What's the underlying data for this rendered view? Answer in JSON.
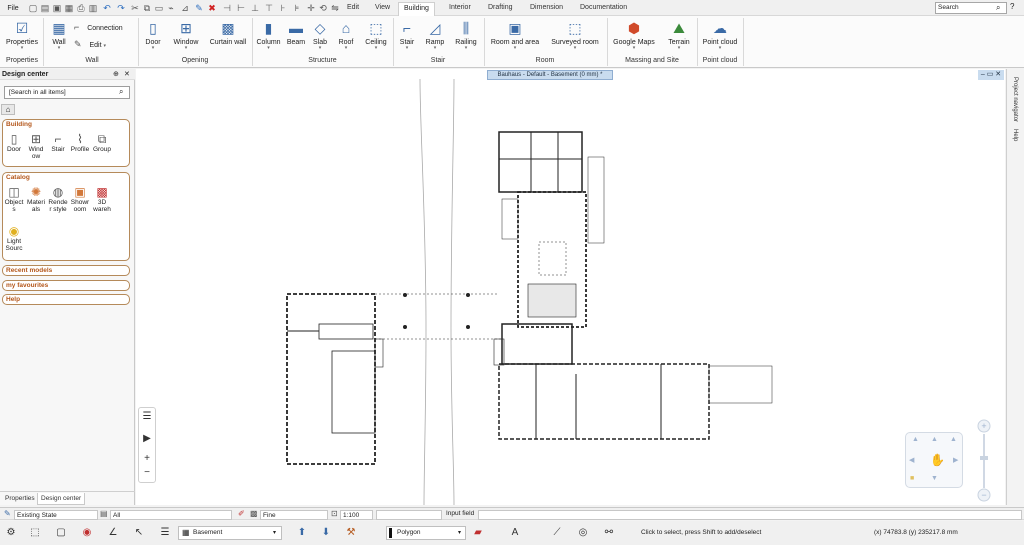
{
  "topbar": {
    "file": "File",
    "menus": [
      "Edit",
      "View",
      "Building",
      "Interior",
      "Drafting",
      "Dimension",
      "Documentation"
    ],
    "active_menu": "Building",
    "search_placeholder": "Search",
    "help": "?"
  },
  "ribbon": {
    "properties": {
      "label": "Properties",
      "group": "Properties"
    },
    "wall": {
      "wall": "Wall",
      "connection": "Connection",
      "edit": "Edit",
      "group": "Wall"
    },
    "opening": {
      "door": "Door",
      "window": "Window",
      "curtain": "Curtain wall",
      "group": "Opening"
    },
    "structure": {
      "column": "Column",
      "beam": "Beam",
      "slab": "Slab",
      "roof": "Roof",
      "ceiling": "Ceiling",
      "group": "Structure"
    },
    "stair": {
      "stair": "Stair",
      "ramp": "Ramp",
      "railing": "Railing",
      "group": "Stair"
    },
    "room": {
      "room_area": "Room and area",
      "surveyed": "Surveyed room",
      "group": "Room"
    },
    "massing": {
      "maps": "Google Maps",
      "terrain": "Terrain",
      "group": "Massing and Site"
    },
    "pointcloud": {
      "label": "Point cloud",
      "group": "Point cloud"
    }
  },
  "design_center": {
    "title": "Design center",
    "search_placeholder": "[Search in all items]",
    "building": {
      "title": "Building",
      "items": [
        "Door",
        "Wind\now",
        "Stair",
        "Profile",
        "Group"
      ]
    },
    "catalog": {
      "title": "Catalog",
      "items": [
        "Object\ns",
        "Materi\nals",
        "Rende\nr style",
        "Showr\noom",
        "3D\nwareh",
        "Light\nSourc"
      ]
    },
    "recent": "Recent models",
    "favourites": "my favourites",
    "help": "Help",
    "tabs": [
      "Properties",
      "Design center"
    ]
  },
  "canvas": {
    "doc_tab": "Bauhaus - Default - Basement (0 mm) *",
    "right_tabs": [
      "Project navigator",
      "Help"
    ]
  },
  "statusbar1": {
    "state": "Existing State",
    "layer": "All",
    "quality": "Fine",
    "scale": "1:100",
    "input_label": "Input field"
  },
  "statusbar2": {
    "storey": "Basement",
    "polygon": "Polygon",
    "hint": "Click to select, press Shift to add/deselect",
    "coords": "(x) 74783.8  (y) 235217.8 mm"
  },
  "colors": {
    "accent": "#3a6aa6",
    "section_border": "#b58a5a",
    "section_title": "#b4571b",
    "doc_tab": "#c9dcef"
  }
}
